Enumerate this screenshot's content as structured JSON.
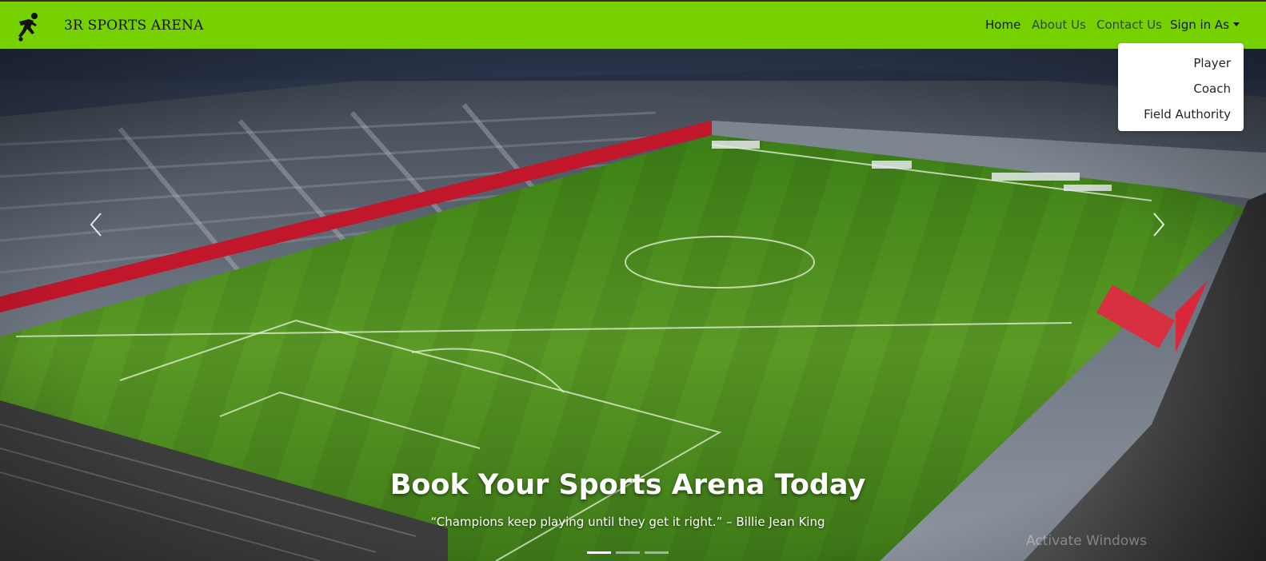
{
  "brand": {
    "name": "3R SPORTS ARENA",
    "logo_icon": "soccer-player-icon"
  },
  "nav": {
    "home": "Home",
    "about": "About Us",
    "contact": "Contact Us",
    "signin": "Sign in As"
  },
  "dropdown": {
    "items": [
      "Player",
      "Coach",
      "Field Authority"
    ]
  },
  "carousel": {
    "title": "Book Your Sports Arena Today",
    "quote": "“Champions keep playing until they get it right.” – Billie Jean King",
    "prev_icon": "chevron-left-icon",
    "next_icon": "chevron-right-icon",
    "slide_count": 3,
    "active_slide": 1
  },
  "watermark": "Activate Windows",
  "colors": {
    "navbar": "#77d100",
    "pitch": "#4f8f1e",
    "stands": "#5a6470"
  }
}
